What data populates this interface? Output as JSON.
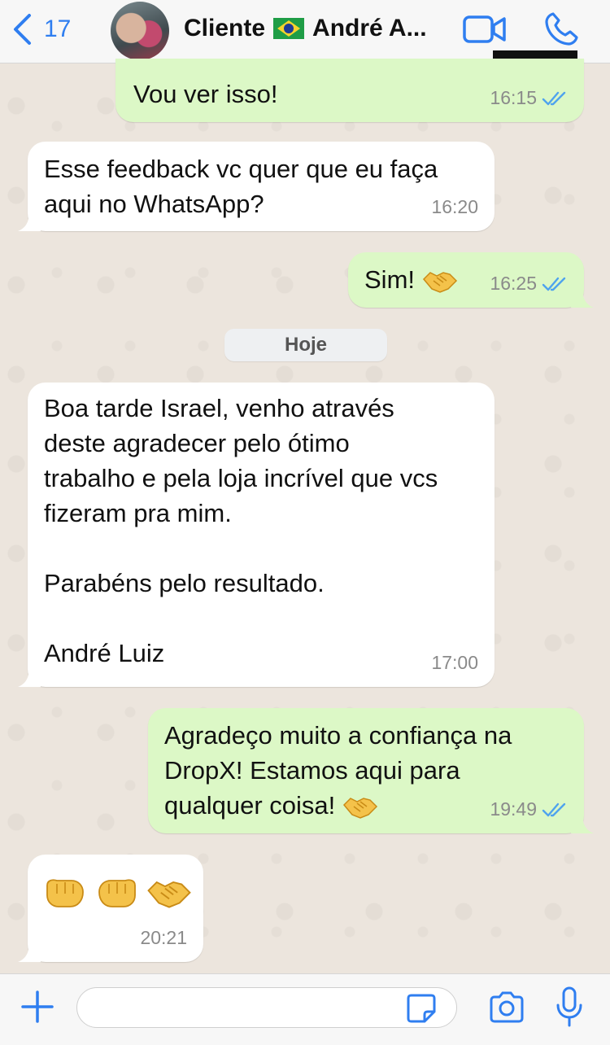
{
  "header": {
    "back_count": "17",
    "title_prefix": "Cliente",
    "title_suffix": "André A...",
    "colors": {
      "accent": "#2f7ef0",
      "bar_bg": "#f7f7f7"
    }
  },
  "messages": [
    {
      "direction": "out",
      "text": "Vou ver isso!",
      "time": "16:15",
      "status": "read"
    },
    {
      "direction": "in",
      "text": "Esse feedback vc quer que eu faça\naqui no WhatsApp?",
      "time": "16:20"
    },
    {
      "direction": "out",
      "text": "Sim!",
      "emoji": "handshake",
      "time": "16:25",
      "status": "read"
    },
    {
      "direction": "in",
      "text": "Boa tarde Israel, venho através\ndeste agradecer pelo ótimo\ntrabalho e pela loja incrível que vcs\nfizeram pra mim.\n\nParabéns pelo resultado.\n\nAndré Luiz",
      "time": "17:00"
    },
    {
      "direction": "out",
      "text": "Agradeço muito a confiança na\nDropX! Estamos aqui para\nqualquer coisa!",
      "emoji": "handshake",
      "time": "19:49",
      "status": "read"
    },
    {
      "direction": "in",
      "emojis": [
        "left-fist",
        "right-fist",
        "handshake"
      ],
      "time": "20:21"
    }
  ],
  "date_separator": "Hoje",
  "input": {
    "value": "",
    "placeholder": ""
  },
  "colors": {
    "incoming_bubble": "#ffffff",
    "outgoing_bubble": "#dcf8c6",
    "read_ticks": "#4fa3ee",
    "chat_bg": "#ece5dd"
  }
}
